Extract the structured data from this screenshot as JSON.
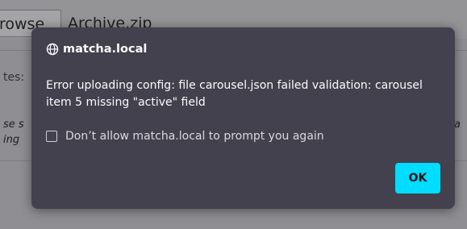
{
  "background": {
    "browse_label": "rowse",
    "file_name": "Archive.zip",
    "notes_fragment": "tes:",
    "italic_line1": "se s",
    "italic_line2": "ing",
    "italic_right": "a"
  },
  "dialog": {
    "origin": "matcha.local",
    "message": "Error uploading config: file carousel.json failed validation: carousel item 5 missing \"active\" field",
    "checkbox_label": "Don’t allow matcha.local to prompt you again",
    "checkbox_checked": false,
    "ok_label": "OK",
    "icon": "globe-icon",
    "colors": {
      "dialog_bg": "#42414d",
      "accent": "#00ddff",
      "text": "#fbfbfe"
    }
  }
}
